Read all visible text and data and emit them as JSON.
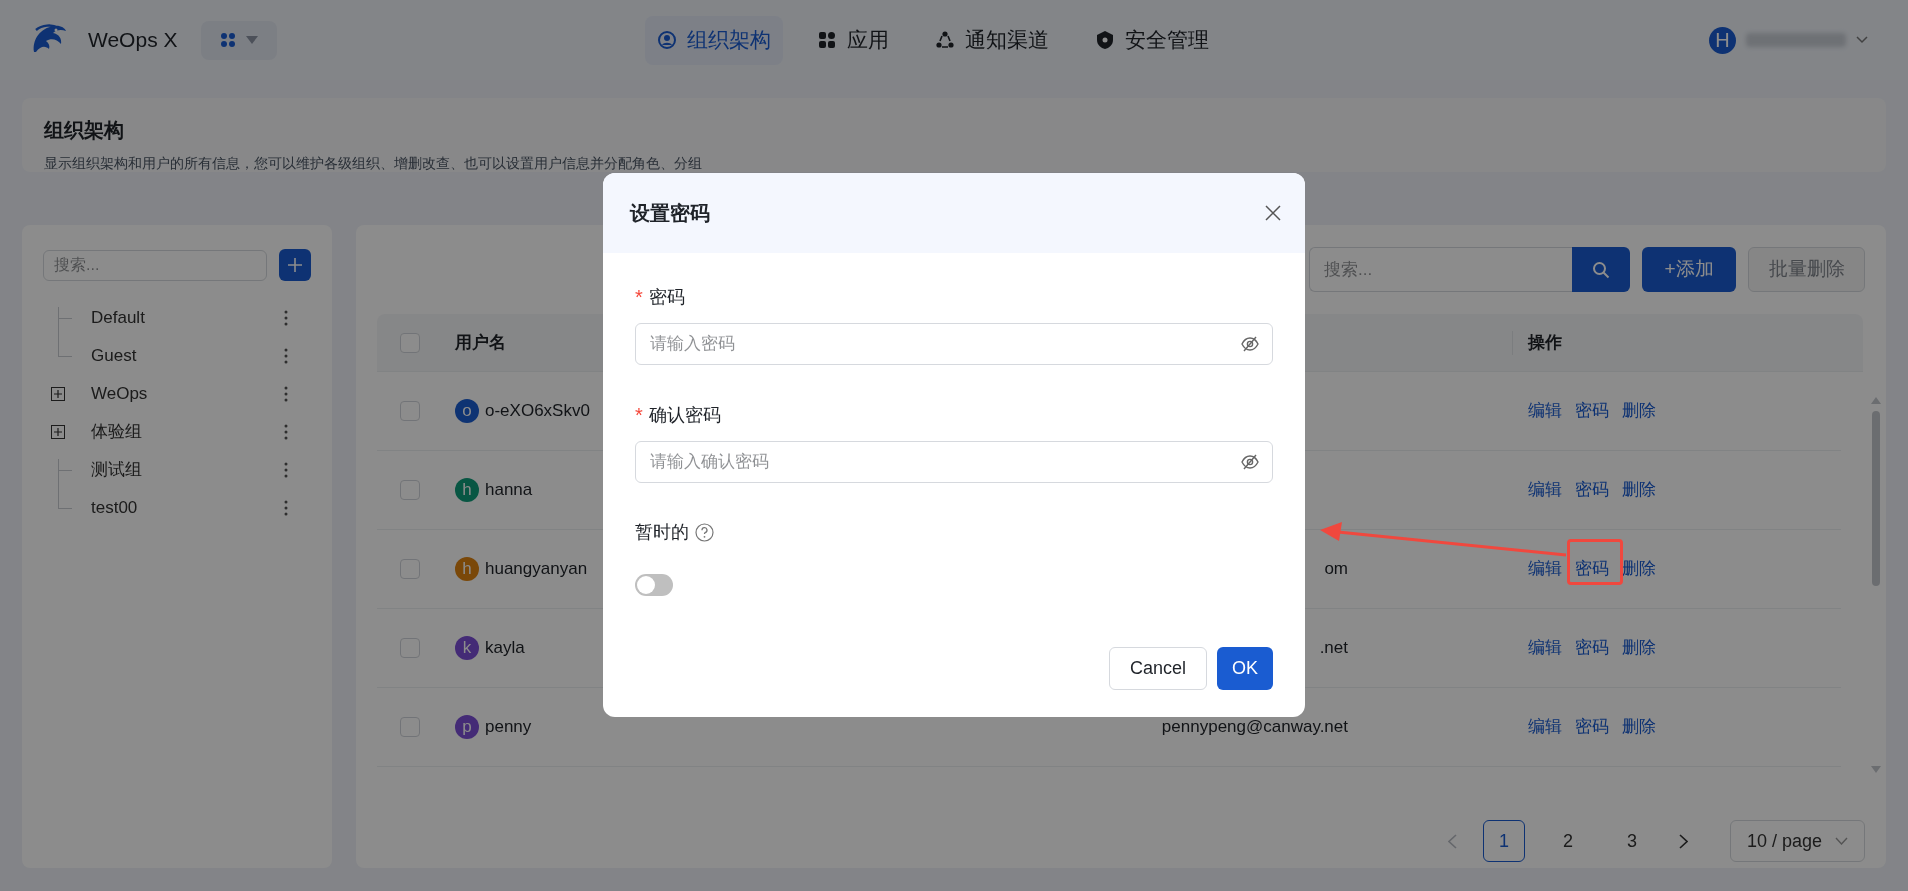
{
  "app": {
    "name": "WeOps X"
  },
  "nav": [
    {
      "label": "组织架构",
      "selected": true
    },
    {
      "label": "应用",
      "selected": false
    },
    {
      "label": "通知渠道",
      "selected": false
    },
    {
      "label": "安全管理",
      "selected": false
    }
  ],
  "user": {
    "initial": "H"
  },
  "page_header": {
    "title": "组织架构",
    "description": "显示组织架构和用户的所有信息，您可以维护各级组织、增删改查、也可以设置用户信息并分配角色、分组"
  },
  "sidebar": {
    "search_placeholder": "搜索...",
    "tree": [
      {
        "label": "Default",
        "kind": "leaf"
      },
      {
        "label": "Guest",
        "kind": "leaf"
      },
      {
        "label": "WeOps",
        "kind": "group"
      },
      {
        "label": "体验组",
        "kind": "group"
      },
      {
        "label": "测试组",
        "kind": "leaf"
      },
      {
        "label": "test00",
        "kind": "leaf"
      }
    ]
  },
  "toolbar": {
    "search_placeholder": "搜索...",
    "add_label": "+添加",
    "bulk_delete": {
      "label": "批量删除",
      "disabled": true
    }
  },
  "table": {
    "columns": [
      "用户名",
      "操作"
    ],
    "select_all_checked": false,
    "rows": [
      {
        "checked": false,
        "initial": "o",
        "color": "#0e3373",
        "username": "o-eXO6xSkv0",
        "actions": [
          "编辑",
          "密码",
          "删除"
        ]
      },
      {
        "checked": false,
        "initial": "h",
        "color": "#085643",
        "username": "hanna",
        "actions": [
          "编辑",
          "密码",
          "删除"
        ]
      },
      {
        "checked": false,
        "initial": "h",
        "color": "#7a4809",
        "username": "huangyanyan",
        "email": "om",
        "actions": [
          "编辑",
          "密码",
          "删除"
        ]
      },
      {
        "checked": false,
        "initial": "k",
        "color": "#442b76",
        "username": "kayla",
        "email": ".net",
        "actions": [
          "编辑",
          "密码",
          "删除"
        ]
      },
      {
        "checked": false,
        "initial": "p",
        "color": "#442b76",
        "username": "penny",
        "email": "pennypeng@canway.net",
        "actions": [
          "编辑",
          "密码",
          "删除"
        ]
      }
    ]
  },
  "pagination": {
    "pages": [
      {
        "label": "1",
        "selected": true
      },
      {
        "label": "2",
        "selected": false
      },
      {
        "label": "3",
        "selected": false
      }
    ],
    "page_size": "10 / page"
  },
  "modal": {
    "title": "设置密码",
    "fields": [
      {
        "label": "密码",
        "required_mark": "*",
        "placeholder": "请输入密码"
      },
      {
        "label": "确认密码",
        "required_mark": "*",
        "placeholder": "请输入确认密码"
      }
    ],
    "temporary": {
      "label": "暂时的",
      "on": false
    },
    "buttons": [
      {
        "label": "Cancel",
        "kind": "default"
      },
      {
        "label": "OK",
        "kind": "primary"
      }
    ]
  }
}
